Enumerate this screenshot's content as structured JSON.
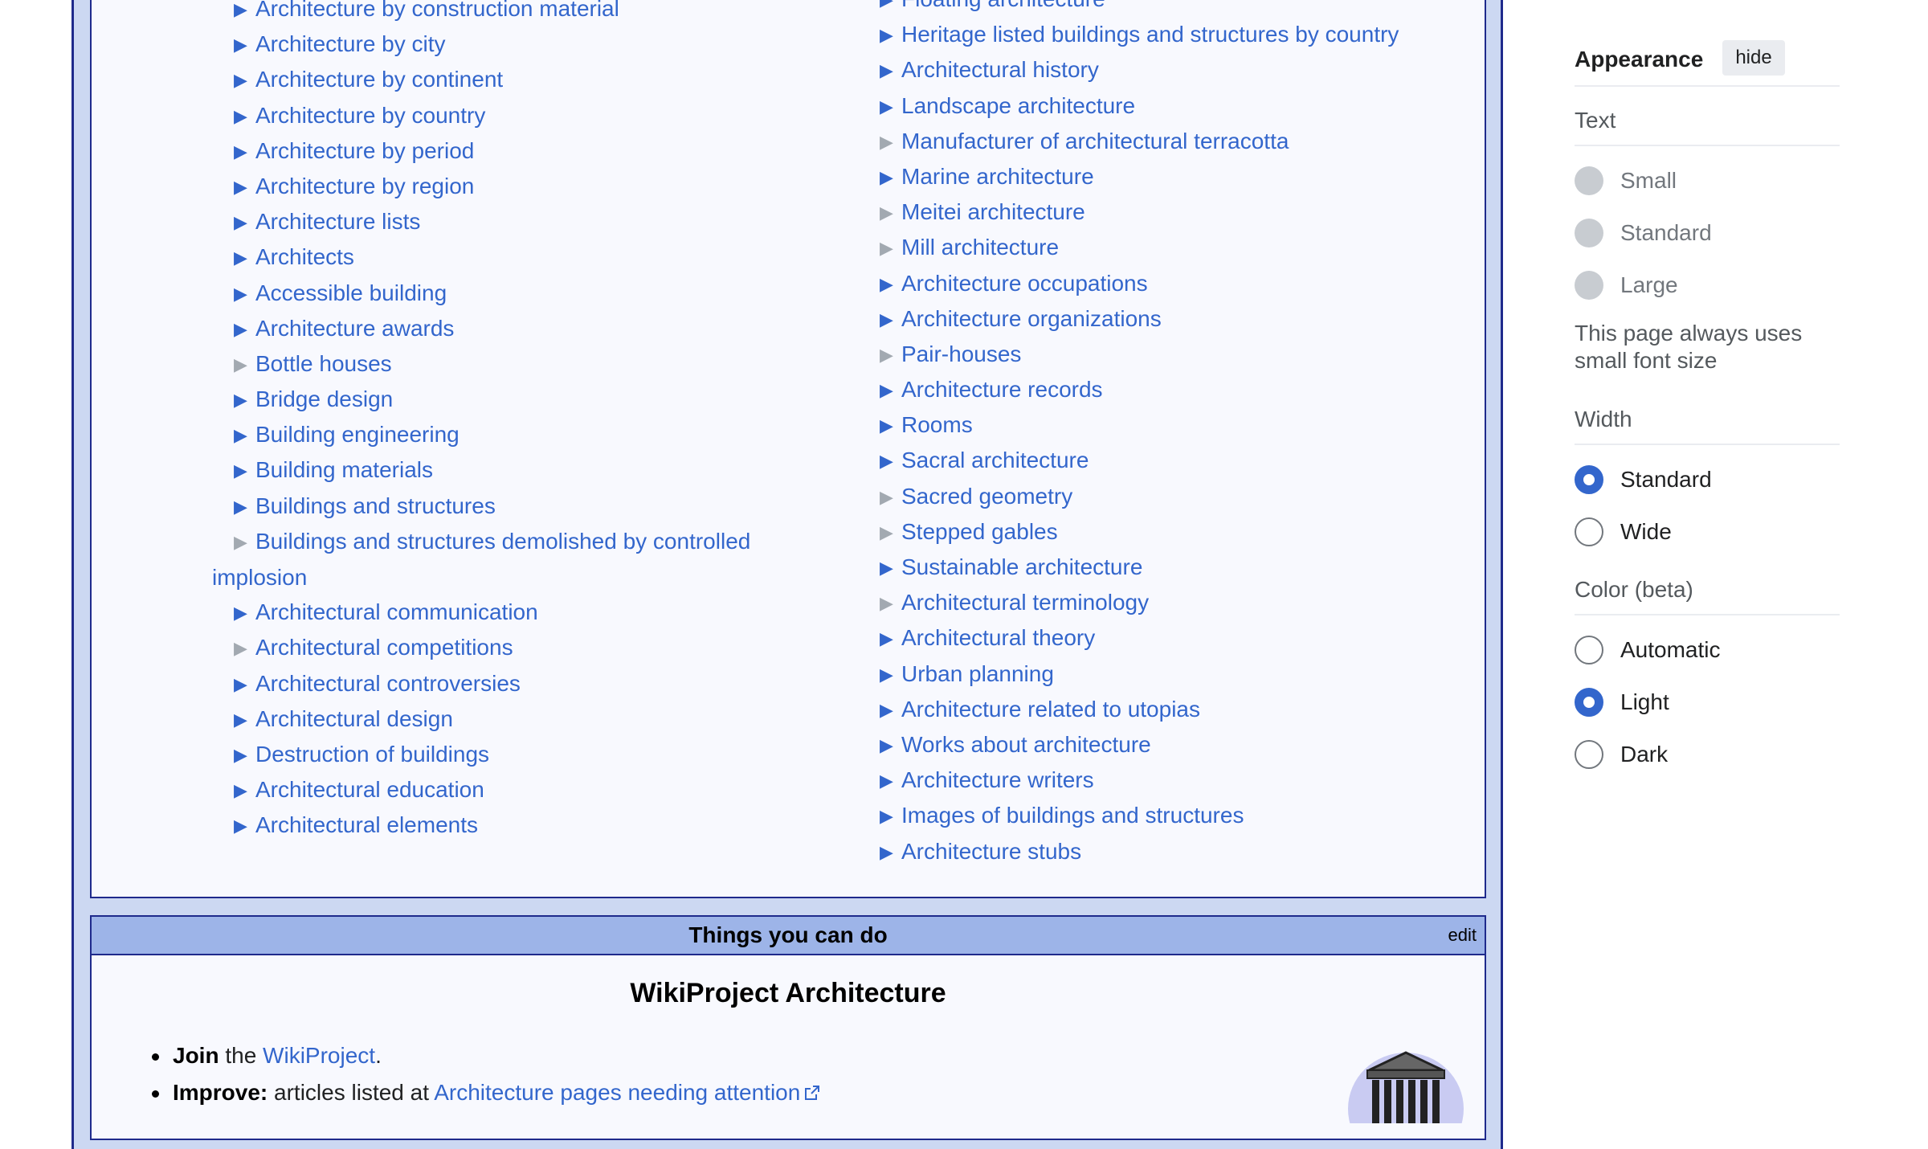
{
  "categories": {
    "left": [
      {
        "label": "Architecture by construction material",
        "expandable": true
      },
      {
        "label": "Architecture by city",
        "expandable": true
      },
      {
        "label": "Architecture by continent",
        "expandable": true
      },
      {
        "label": "Architecture by country",
        "expandable": true
      },
      {
        "label": "Architecture by period",
        "expandable": true
      },
      {
        "label": "Architecture by region",
        "expandable": true
      },
      {
        "label": "Architecture lists",
        "expandable": true
      },
      {
        "label": "Architects",
        "expandable": true
      },
      {
        "label": "Accessible building",
        "expandable": true
      },
      {
        "label": "Architecture awards",
        "expandable": true
      },
      {
        "label": "Bottle houses",
        "expandable": false
      },
      {
        "label": "Bridge design",
        "expandable": true
      },
      {
        "label": "Building engineering",
        "expandable": true
      },
      {
        "label": "Building materials",
        "expandable": true
      },
      {
        "label": "Buildings and structures",
        "expandable": true
      },
      {
        "label": "Buildings and structures demolished by controlled",
        "label_cont": "implosion",
        "expandable": false
      },
      {
        "label": "Architectural communication",
        "expandable": true
      },
      {
        "label": "Architectural competitions",
        "expandable": false
      },
      {
        "label": "Architectural controversies",
        "expandable": true
      },
      {
        "label": "Architectural design",
        "expandable": true
      },
      {
        "label": "Destruction of buildings",
        "expandable": true
      },
      {
        "label": "Architectural education",
        "expandable": true
      },
      {
        "label": "Architectural elements",
        "expandable": true
      }
    ],
    "right": [
      {
        "label": "Floating architecture",
        "expandable": true
      },
      {
        "label": "Heritage listed buildings and structures by country",
        "expandable": true
      },
      {
        "label": "Architectural history",
        "expandable": true
      },
      {
        "label": "Landscape architecture",
        "expandable": true
      },
      {
        "label": "Manufacturer of architectural terracotta",
        "expandable": false
      },
      {
        "label": "Marine architecture",
        "expandable": true
      },
      {
        "label": "Meitei architecture",
        "expandable": false
      },
      {
        "label": "Mill architecture",
        "expandable": false
      },
      {
        "label": "Architecture occupations",
        "expandable": true
      },
      {
        "label": "Architecture organizations",
        "expandable": true
      },
      {
        "label": "Pair-houses",
        "expandable": false
      },
      {
        "label": "Architecture records",
        "expandable": true
      },
      {
        "label": "Rooms",
        "expandable": true
      },
      {
        "label": "Sacral architecture",
        "expandable": true
      },
      {
        "label": "Sacred geometry",
        "expandable": false
      },
      {
        "label": "Stepped gables",
        "expandable": false
      },
      {
        "label": "Sustainable architecture",
        "expandable": true
      },
      {
        "label": "Architectural terminology",
        "expandable": false
      },
      {
        "label": "Architectural theory",
        "expandable": true
      },
      {
        "label": "Urban planning",
        "expandable": true
      },
      {
        "label": "Architecture related to utopias",
        "expandable": true
      },
      {
        "label": "Works about architecture",
        "expandable": true
      },
      {
        "label": "Architecture writers",
        "expandable": true
      },
      {
        "label": "Images of buildings and structures",
        "expandable": true
      },
      {
        "label": "Architecture stubs",
        "expandable": true
      }
    ]
  },
  "things": {
    "header": "Things you can do",
    "edit_label": "edit",
    "title": "WikiProject Architecture",
    "join_bold": "Join",
    "join_the": " the ",
    "join_link": "WikiProject",
    "join_end": ".",
    "improve_bold": "Improve:",
    "improve_text": " articles listed at ",
    "improve_link": "Architecture pages needing attention"
  },
  "appearance": {
    "title": "Appearance",
    "hide_label": "hide",
    "text_title": "Text",
    "text_options": [
      "Small",
      "Standard",
      "Large"
    ],
    "text_note": "This page always uses small font size",
    "width_title": "Width",
    "width_options": [
      "Standard",
      "Wide"
    ],
    "width_selected": "Standard",
    "color_title": "Color (beta)",
    "color_options": [
      "Automatic",
      "Light",
      "Dark"
    ],
    "color_selected": "Light"
  },
  "icons": {
    "expand": "triangle-right-icon",
    "external": "external-link-icon",
    "portal": "temple-icon"
  },
  "colors": {
    "link": "#3366cc",
    "frame_border": "#1f2a8c",
    "header_bg": "#9db4e8",
    "frame_bg": "#ccd8f2",
    "box_bg": "#f8f9fe",
    "radio_checked": "#3366cc"
  }
}
